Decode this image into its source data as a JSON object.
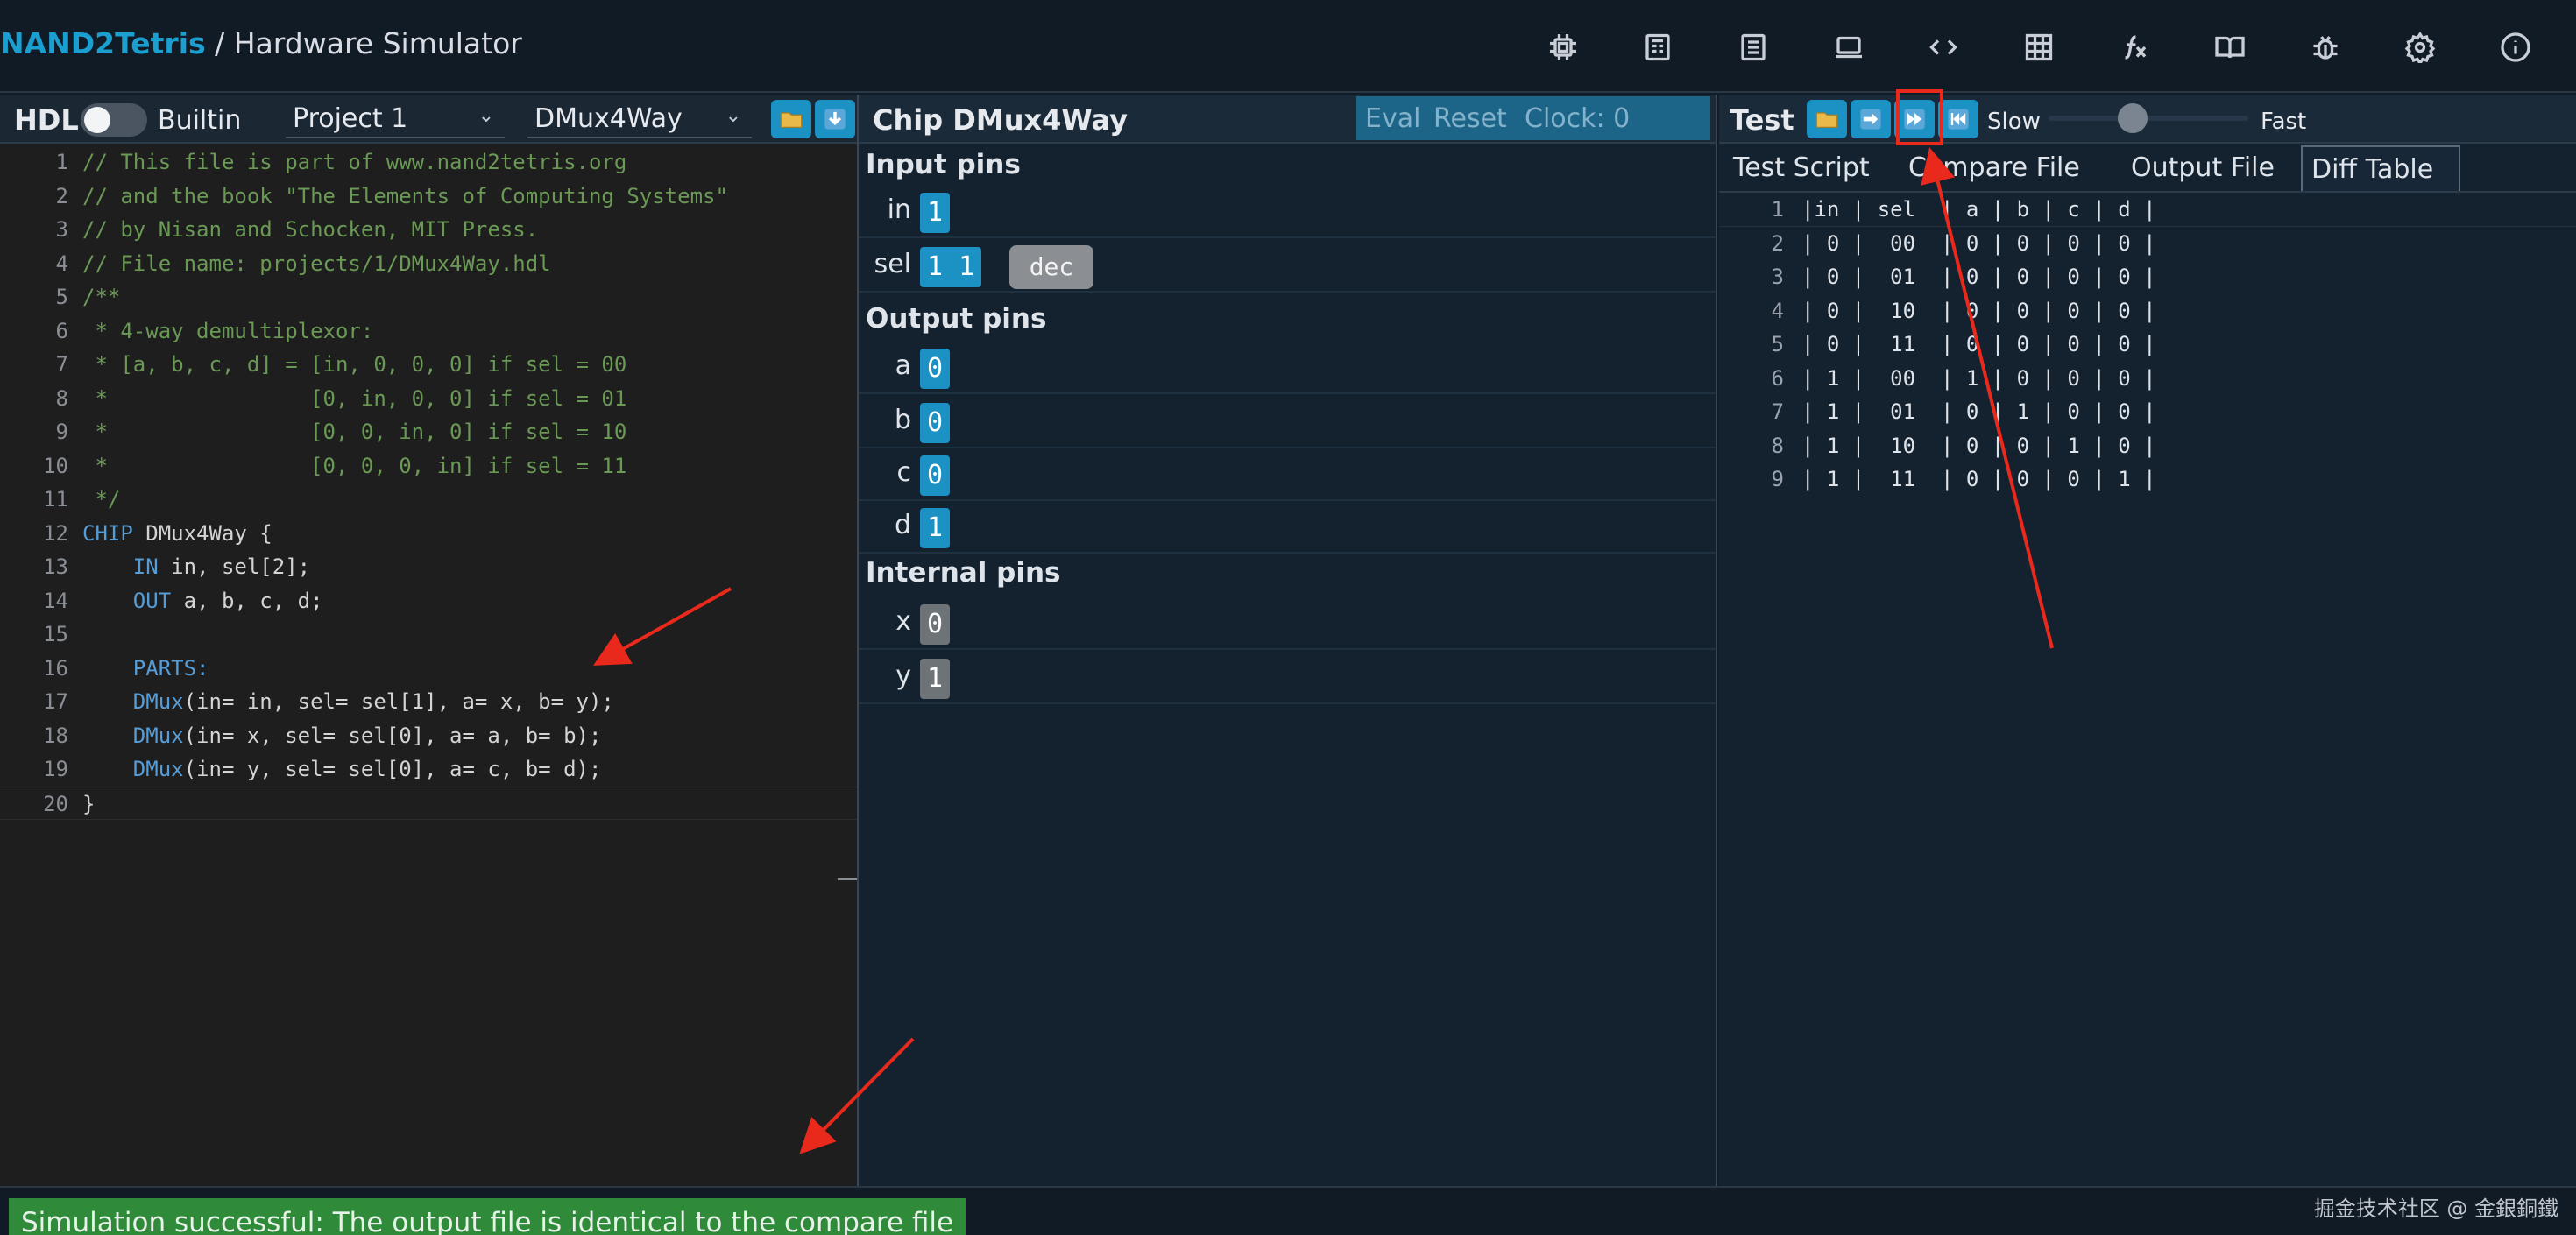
{
  "app": {
    "brand": "NAND2Tetris",
    "separator": " / ",
    "title": "Hardware Simulator"
  },
  "topbar_icons": [
    "chip-icon",
    "cpu-icon",
    "list-icon",
    "laptop-icon",
    "code-icon",
    "grid-icon",
    "function-icon",
    "book-icon",
    "bug-icon",
    "settings-icon",
    "info-icon"
  ],
  "hdl": {
    "title": "HDL",
    "builtin_label": "Builtin",
    "project_select": "Project 1",
    "chip_select": "DMux4Way",
    "lines": [
      "// This file is part of www.nand2tetris.org",
      "// and the book \"The Elements of Computing Systems\"",
      "// by Nisan and Schocken, MIT Press.",
      "// File name: projects/1/DMux4Way.hdl",
      "/**",
      " * 4-way demultiplexor:",
      " * [a, b, c, d] = [in, 0, 0, 0] if sel = 00",
      " *                [0, in, 0, 0] if sel = 01",
      " *                [0, 0, in, 0] if sel = 10",
      " *                [0, 0, 0, in] if sel = 11",
      " */",
      "CHIP DMux4Way {",
      "    IN in, sel[2];",
      "    OUT a, b, c, d;",
      "",
      "    PARTS:",
      "    DMux(in= in, sel= sel[1], a= x, b= y);",
      "    DMux(in= x, sel= sel[0], a= a, b= b);",
      "    DMux(in= y, sel= sel[0], a= c, b= d);",
      "}"
    ]
  },
  "chip": {
    "title": "Chip DMux4Way",
    "actions": {
      "eval": "Eval",
      "reset": "Reset",
      "clock": "Clock: 0"
    },
    "input_title": "Input pins",
    "inputs": [
      {
        "name": "in",
        "value": "1"
      },
      {
        "name": "sel",
        "value": "1 1",
        "format_button": "dec"
      }
    ],
    "output_title": "Output pins",
    "outputs": [
      {
        "name": "a",
        "value": "0"
      },
      {
        "name": "b",
        "value": "0"
      },
      {
        "name": "c",
        "value": "0"
      },
      {
        "name": "d",
        "value": "1"
      }
    ],
    "internal_title": "Internal pins",
    "internals": [
      {
        "name": "x",
        "value": "0"
      },
      {
        "name": "y",
        "value": "1"
      }
    ]
  },
  "test": {
    "title": "Test",
    "speed_slow": "Slow",
    "speed_fast": "Fast",
    "speed_level": 0.42,
    "tabs": [
      "Test Script",
      "Compare File",
      "Output File",
      "Diff Table"
    ],
    "selected_tab": "Diff Table",
    "diff_lines": [
      "|in | sel  | a | b | c | d |",
      "| 0 |  00  | 0 | 0 | 0 | 0 |",
      "| 0 |  01  | 0 | 0 | 0 | 0 |",
      "| 0 |  10  | 0 | 0 | 0 | 0 |",
      "| 0 |  11  | 0 | 0 | 0 | 0 |",
      "| 1 |  00  | 1 | 0 | 0 | 0 |",
      "| 1 |  01  | 0 | 1 | 0 | 0 |",
      "| 1 |  10  | 0 | 0 | 1 | 0 |",
      "| 1 |  11  | 0 | 0 | 0 | 1 |"
    ]
  },
  "status": {
    "message": "Simulation successful: The output file is identical to the compare file",
    "watermark": "掘金技术社区 @ 金銀銅鐵"
  },
  "colors": {
    "accent": "#1b91c4",
    "success": "#2f8b3a",
    "annotation": "#e8291c",
    "comment": "#6a9955",
    "keyword": "#569cd6"
  }
}
